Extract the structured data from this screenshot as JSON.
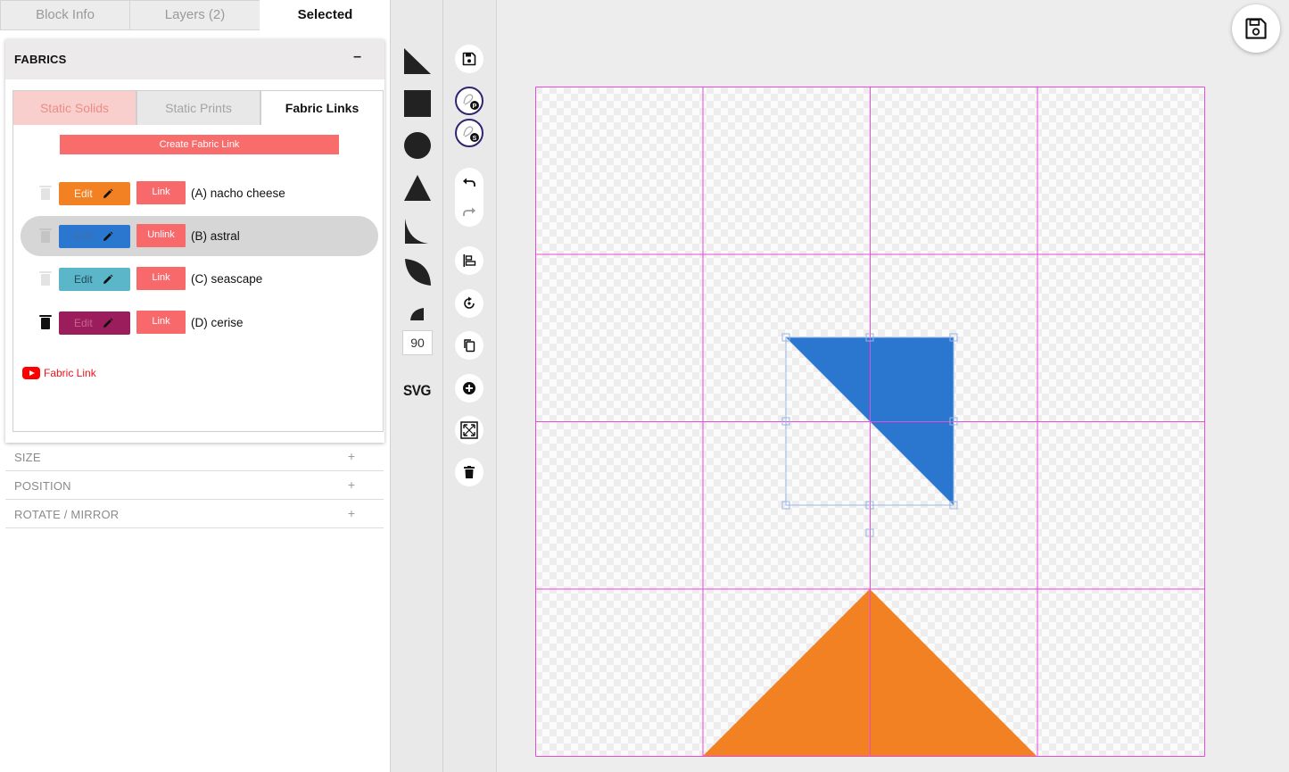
{
  "main_tabs": [
    {
      "label": "Block Info"
    },
    {
      "label": "Layers (2)"
    },
    {
      "label": "Selected"
    }
  ],
  "fabrics": {
    "title": "FABRICS",
    "collapse_symbol": "–",
    "sub_tabs": [
      {
        "label": "Static Solids"
      },
      {
        "label": "Static Prints"
      },
      {
        "label": "Fabric Links"
      }
    ],
    "create_link_label": "Create Fabric Link",
    "rows": [
      {
        "name": "(A) nacho cheese",
        "edit_label": "Edit",
        "link_label": "Link",
        "color": "#f28123",
        "highlighted": false
      },
      {
        "name": "(B) astral",
        "edit_label": "Edit",
        "link_label": "Unlink",
        "color": "#2b77cf",
        "highlighted": true
      },
      {
        "name": "(C) seascape",
        "edit_label": "Edit",
        "link_label": "Link",
        "color": "#5bb6c9",
        "highlighted": false
      },
      {
        "name": "(D) cerise",
        "edit_label": "Edit",
        "link_label": "Link",
        "color": "#9c1d5c",
        "highlighted": false
      }
    ],
    "video_link_label": "Fabric Link"
  },
  "accordions": [
    {
      "label": "SIZE",
      "symbol": "+"
    },
    {
      "label": "POSITION",
      "symbol": "+"
    },
    {
      "label": "ROTATE / MIRROR",
      "symbol": "+"
    }
  ],
  "shape_tools": {
    "items": [
      "right-triangle-icon",
      "square-icon",
      "circle-icon",
      "triangle-icon",
      "quarter-curve-icon",
      "leaf-icon",
      "small-quarter-circle-icon"
    ],
    "rotate_value": "90",
    "svg_label": "SVG"
  },
  "tools": [
    "save-icon",
    "badge-p-icon",
    "badge-s-icon",
    "undo-icon",
    "redo-icon",
    "align-icon",
    "rotate-icon",
    "copy-icon",
    "add-icon",
    "fit-screen-icon",
    "delete-icon"
  ],
  "canvas": {
    "grid_size": 4,
    "grid_color": "#e84ad9",
    "shapes": [
      {
        "fabric": "(B) astral",
        "type": "right-triangle",
        "color": "#2b77cf",
        "selected": true
      },
      {
        "fabric": "(A) nacho cheese",
        "type": "triangle",
        "color": "#f28123",
        "selected": false
      }
    ]
  },
  "colors": {
    "accent": "#f86c6c",
    "selection": "#9ab5e6"
  }
}
